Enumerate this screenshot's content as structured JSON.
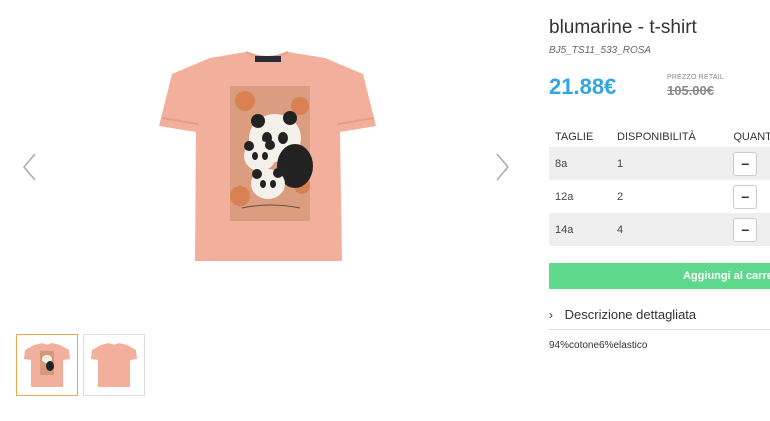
{
  "product": {
    "title": "blumarine - t-shirt",
    "sku": "BJ5_TS11_533_ROSA",
    "price": "21.88€",
    "retail_label": "PREZZO RETAIL",
    "retail_price": "105.00€"
  },
  "sizes_table": {
    "headers": [
      "TAGLIE",
      "DISPONIBILITÀ",
      "QUANTITÀ"
    ],
    "rows": [
      {
        "size": "8a",
        "availability": "1",
        "qty_button": "−"
      },
      {
        "size": "12a",
        "availability": "2",
        "qty_button": "−"
      },
      {
        "size": "14a",
        "availability": "4",
        "qty_button": "−"
      }
    ]
  },
  "add_to_cart_label": "Aggiungi al carrello",
  "description": {
    "toggle_label": "Descrizione dettagliata",
    "text": "94%cotone6%elastico"
  },
  "gallery": {
    "prev_icon": "chevron-left-icon",
    "next_icon": "chevron-right-icon",
    "thumbnails": [
      "front",
      "back"
    ]
  },
  "colors": {
    "price": "#2fa7e0",
    "cart_button": "#5ed88a",
    "shirt": "#f2b09c",
    "thumb_active_border": "#f0a850"
  }
}
